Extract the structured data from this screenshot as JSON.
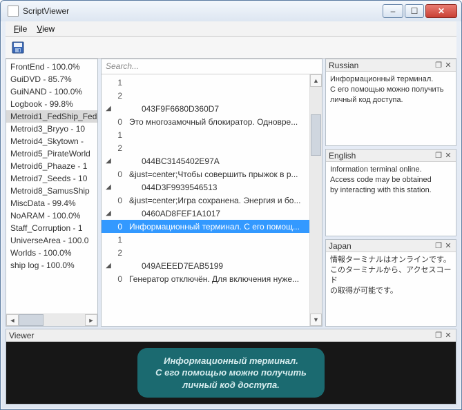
{
  "window": {
    "title": "ScriptViewer"
  },
  "menu": {
    "file": "File",
    "view": "View"
  },
  "search_placeholder": "Search...",
  "left_items": [
    {
      "t": "FrontEnd  -  100.0%"
    },
    {
      "t": "GuiDVD  -  85.7%"
    },
    {
      "t": "GuiNAND  -  100.0%"
    },
    {
      "t": "Logbook  -  99.8%"
    },
    {
      "t": "Metroid1_FedShip_Fed",
      "sel": true
    },
    {
      "t": "Metroid3_Bryyo  -  10"
    },
    {
      "t": "Metroid4_Skytown  -  "
    },
    {
      "t": "Metroid5_PirateWorld"
    },
    {
      "t": "Metroid6_Phaaze  -  1"
    },
    {
      "t": "Metroid7_Seeds  -  10"
    },
    {
      "t": "Metroid8_SamusShip  "
    },
    {
      "t": "MiscData  -  99.4%"
    },
    {
      "t": "NoARAM  -  100.0%"
    },
    {
      "t": "Staff_Corruption  -  1"
    },
    {
      "t": "UniverseArea  -  100.0"
    },
    {
      "t": "Worlds  -  100.0%"
    },
    {
      "t": "ship log  -  100.0%"
    }
  ],
  "tree": [
    {
      "tog": "",
      "idx": "1",
      "txt": ""
    },
    {
      "tog": "",
      "idx": "2",
      "txt": ""
    },
    {
      "tog": "◢",
      "idx": "",
      "txt": "043F9F6680D360D7",
      "hdr": true
    },
    {
      "tog": "",
      "idx": "0",
      "txt": "Это многозамочный блокиратор. Одновре..."
    },
    {
      "tog": "",
      "idx": "1",
      "txt": ""
    },
    {
      "tog": "",
      "idx": "2",
      "txt": ""
    },
    {
      "tog": "◢",
      "idx": "",
      "txt": "044BC3145402E97A",
      "hdr": true
    },
    {
      "tog": "",
      "idx": "0",
      "txt": "&just=center;Чтобы совершить прыжок в р..."
    },
    {
      "tog": "◢",
      "idx": "",
      "txt": "044D3F9939546513",
      "hdr": true
    },
    {
      "tog": "",
      "idx": "0",
      "txt": "&just=center;Игра сохранена. Энергия и бо..."
    },
    {
      "tog": "◢",
      "idx": "",
      "txt": "0460AD8FEF1A1017",
      "hdr": true
    },
    {
      "tog": "",
      "idx": "0",
      "txt": "Информационный терминал. С его помощ...",
      "sel": true
    },
    {
      "tog": "",
      "idx": "1",
      "txt": ""
    },
    {
      "tog": "",
      "idx": "2",
      "txt": ""
    },
    {
      "tog": "◢",
      "idx": "",
      "txt": "049AEEED7EAB5199",
      "hdr": true
    },
    {
      "tog": "",
      "idx": "0",
      "txt": "Генератор отключён. Для включения нуже..."
    }
  ],
  "lang": {
    "ru": {
      "title": "Russian",
      "text": "Информационный терминал.\nС его помощью можно получить\nличный код доступа."
    },
    "en": {
      "title": "English",
      "text": "Information terminal online.\nAccess code may be obtained\nby interacting with this station."
    },
    "jp": {
      "title": "Japan",
      "text": "情報ターミナルはオンラインです。\nこのターミナルから、アクセスコード\nの取得が可能です。"
    }
  },
  "viewer": {
    "title": "Viewer",
    "bubble": "Информационный терминал.\nС его помощью можно получить\nличный код доступа."
  }
}
